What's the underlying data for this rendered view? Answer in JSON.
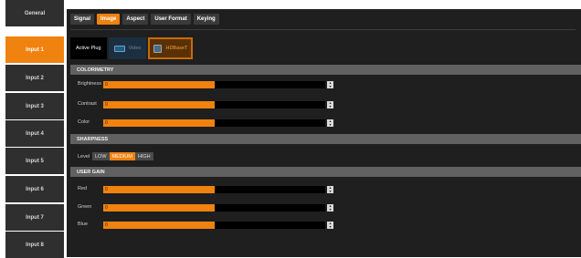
{
  "sidebar": {
    "items": [
      {
        "label": "General",
        "active": false
      },
      {
        "label": "Input 1",
        "active": true
      },
      {
        "label": "Input 2",
        "active": false
      },
      {
        "label": "Input 3",
        "active": false
      },
      {
        "label": "Input 4",
        "active": false
      },
      {
        "label": "Input 5",
        "active": false
      },
      {
        "label": "Input 6",
        "active": false
      },
      {
        "label": "Input 7",
        "active": false
      },
      {
        "label": "Input 8",
        "active": false
      }
    ]
  },
  "tabs": [
    {
      "label": "Signal",
      "active": false
    },
    {
      "label": "Image",
      "active": true
    },
    {
      "label": "Aspect",
      "active": false
    },
    {
      "label": "User Format",
      "active": false
    },
    {
      "label": "Keying",
      "active": false
    }
  ],
  "sources": {
    "active_plug": "Active Plug",
    "video": "Video",
    "hdbaset": "HDBaseT"
  },
  "sections": {
    "colorimetry": "COLORIMETRY",
    "sharpness": "SHARPNESS",
    "user_gain": "USER GAIN"
  },
  "colorimetry": {
    "brightness": {
      "label": "Brightness",
      "value": "0",
      "level": 0.5
    },
    "contrast": {
      "label": "Contrast",
      "value": "0",
      "level": 0.5
    },
    "color": {
      "label": "Color",
      "value": "0",
      "level": 0.5
    }
  },
  "sharpness": {
    "label": "Level",
    "options": [
      "LOW",
      "MEDIUM",
      "HIGH"
    ],
    "selected": "MEDIUM"
  },
  "user_gain": {
    "red": {
      "label": "Red",
      "value": "0",
      "level": 0.5
    },
    "green": {
      "label": "Green",
      "value": "0",
      "level": 0.5
    },
    "blue": {
      "label": "Blue",
      "value": "0",
      "level": 0.5
    }
  },
  "colors": {
    "accent": "#f0820f",
    "panel": "#1f1f1f",
    "section": "#616161"
  }
}
